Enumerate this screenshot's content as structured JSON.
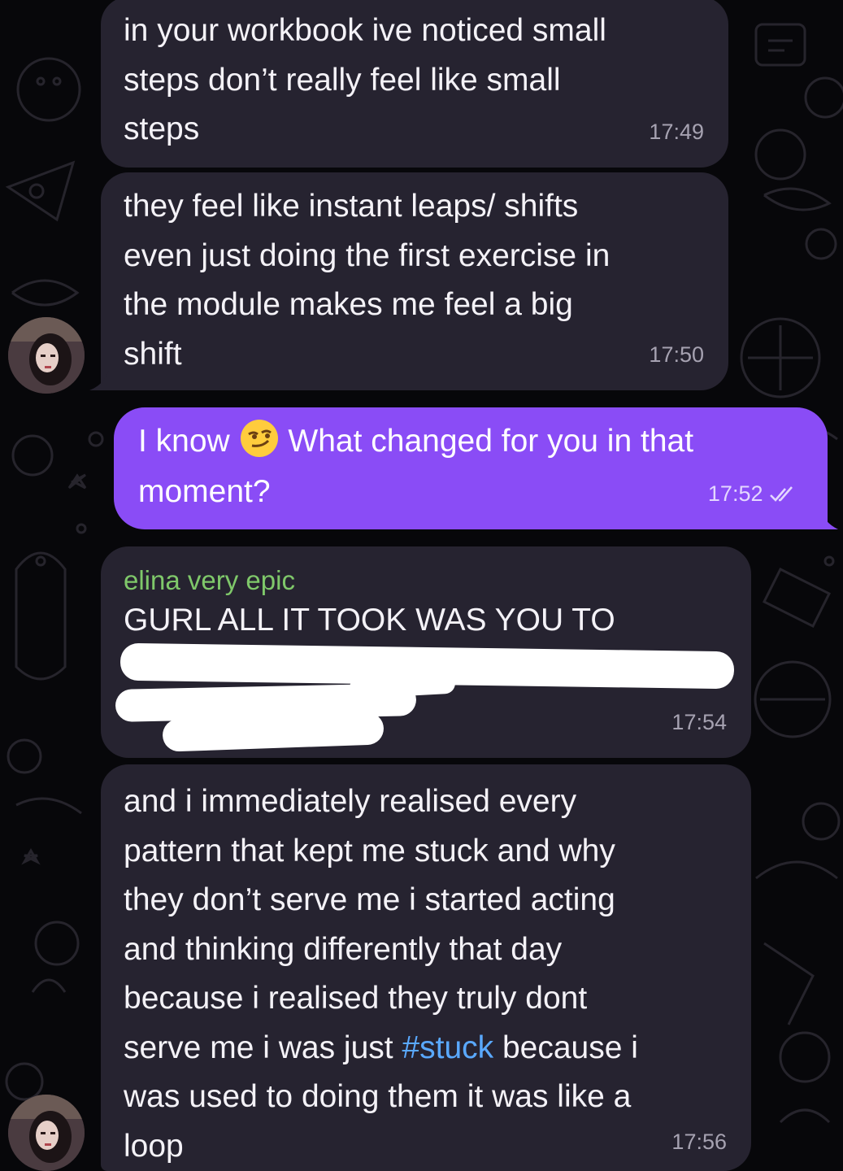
{
  "messages": [
    {
      "id": "m1",
      "direction": "incoming",
      "text": "in your workbook ive noticed small\nsteps don’t really feel like small\nsteps",
      "time": "17:49"
    },
    {
      "id": "m2",
      "direction": "incoming",
      "text": "they feel like instant leaps/ shifts\neven just doing the first exercise in\nthe module makes me feel a big\nshift",
      "time": "17:50"
    },
    {
      "id": "m3",
      "direction": "outgoing",
      "text_before": "I know",
      "emoji": "smirking-face",
      "text_after": "What changed for you in that",
      "text_line2": "moment?",
      "time": "17:52",
      "status": "read-double-check"
    },
    {
      "id": "m4",
      "direction": "incoming",
      "sender": "elina very epic",
      "text": "GURL ALL IT TOOK WAS YOU TO",
      "redacted": true,
      "time": "17:54"
    },
    {
      "id": "m5",
      "direction": "incoming",
      "text_line1": "and i immediately realised every",
      "text_line2": "pattern that kept me stuck and why",
      "text_line3": "they don’t serve me i started acting",
      "text_line4": "and thinking differently that day",
      "text_line5": "because i realised they truly dont",
      "text_line6_before": "serve me i was just ",
      "hashtag": "#stuck",
      "text_line6_after": " because i",
      "text_line7": "was used to doing them it was like a",
      "text_line8": "loop",
      "time": "17:56"
    }
  ],
  "colors": {
    "incoming_bubble": "#262330",
    "outgoing_bubble": "#8a4cf6",
    "sender_name": "#7fc86a",
    "hashtag": "#5aa9ff",
    "background": "#07070a"
  }
}
